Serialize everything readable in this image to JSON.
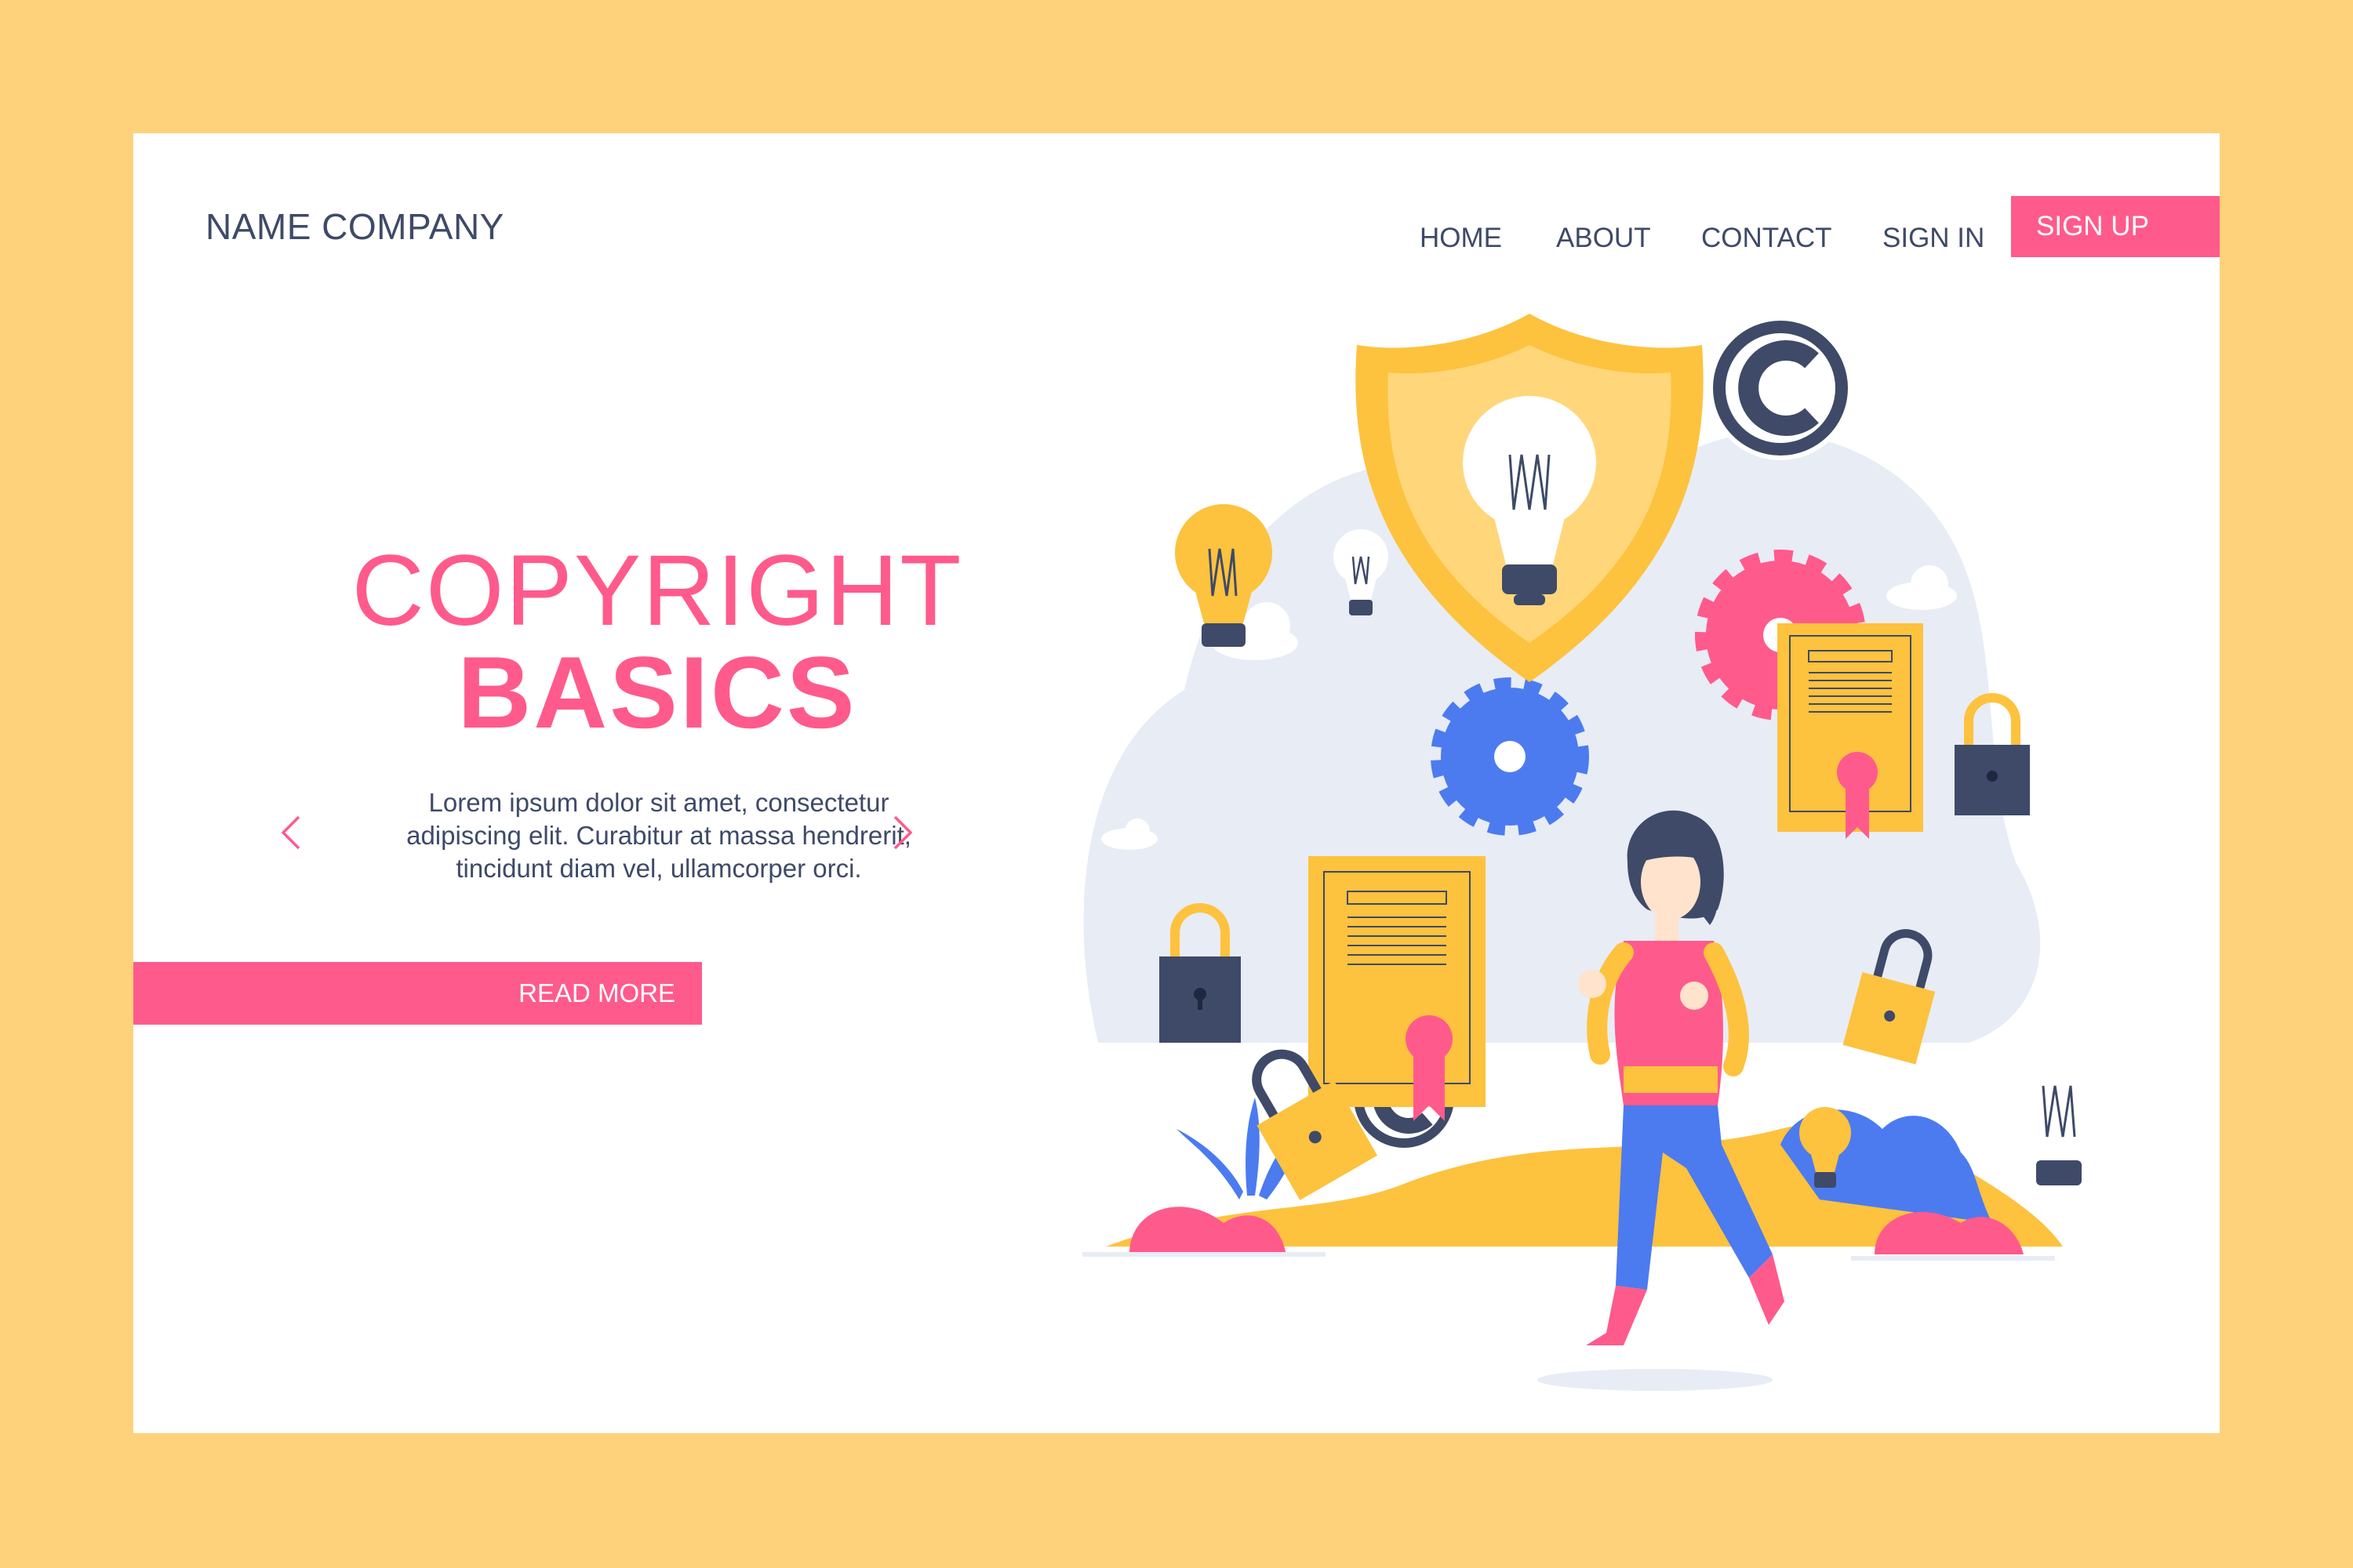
{
  "brand": {
    "name": "NAME COMPANY"
  },
  "nav": {
    "items": [
      "HOME",
      "ABOUT",
      "CONTACT",
      "SIGN IN"
    ],
    "cta": "SIGN UP"
  },
  "hero": {
    "title_line1": "COPYRIGHT",
    "title_line2": "BASICS",
    "description_lines": [
      "Lorem ipsum dolor sit amet, consectetur",
      "adipiscing elit. Curabitur at massa hendrerit,",
      "tincidunt diam vel, ullamcorper orci."
    ],
    "button": "READ MORE",
    "prev_icon": "chevron-left-icon",
    "next_icon": "chevron-right-icon"
  },
  "colors": {
    "background": "#FDD27A",
    "accent": "#FF5A8C",
    "text": "#3E4A68",
    "yellow": "#FDC23E",
    "blue": "#4C7BF0"
  },
  "illustration": {
    "icons": [
      "shield-icon",
      "lightbulb-icon",
      "copyright-icon",
      "padlock-icon",
      "gear-icon",
      "certificate-icon",
      "person-figure",
      "cloud-icon",
      "plant-icon"
    ]
  }
}
